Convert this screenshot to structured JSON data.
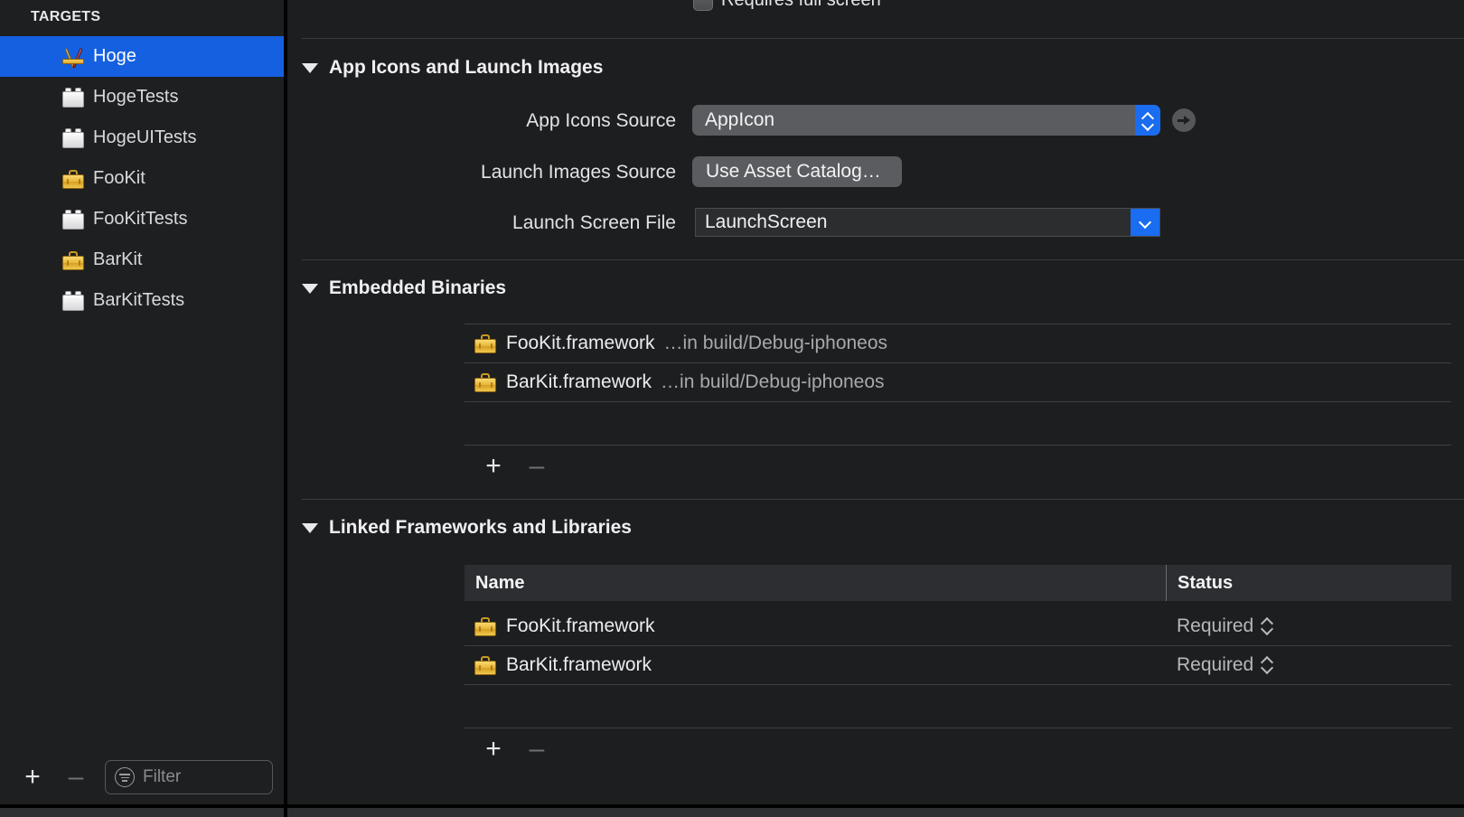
{
  "sidebar": {
    "header": "TARGETS",
    "targets": [
      {
        "label": "Hoge",
        "icon": "app-target-icon",
        "selected": true
      },
      {
        "label": "HogeTests",
        "icon": "test-bundle-icon",
        "selected": false
      },
      {
        "label": "HogeUITests",
        "icon": "test-bundle-icon",
        "selected": false
      },
      {
        "label": "FooKit",
        "icon": "framework-icon",
        "selected": false
      },
      {
        "label": "FooKitTests",
        "icon": "test-bundle-icon",
        "selected": false
      },
      {
        "label": "BarKit",
        "icon": "framework-icon",
        "selected": false
      },
      {
        "label": "BarKitTests",
        "icon": "test-bundle-icon",
        "selected": false
      }
    ],
    "footer": {
      "add_label": "+",
      "remove_label": "–",
      "filter_placeholder": "Filter",
      "filter_icon": "filter-icon"
    }
  },
  "main": {
    "clipped_checkbox": {
      "label": "Requires full screen",
      "checked": false
    },
    "app_icons_section": {
      "title": "App Icons and Launch Images",
      "disclosure_icon": "triangle-down-icon",
      "rows": [
        {
          "label": "App Icons Source",
          "value": "AppIcon",
          "control": "popup-button"
        },
        {
          "label": "Launch Images Source",
          "value": "Use Asset Catalog…",
          "control": "push-button"
        },
        {
          "label": "Launch Screen File",
          "value": "LaunchScreen",
          "control": "combo-box"
        }
      ],
      "goto_button_icon": "arrow-right-circle-icon"
    },
    "embedded_binaries": {
      "title": "Embedded Binaries",
      "disclosure_icon": "triangle-down-icon",
      "items": [
        {
          "name": "FooKit.framework",
          "path": "…in build/Debug-iphoneos",
          "icon": "framework-icon"
        },
        {
          "name": "BarKit.framework",
          "path": "…in build/Debug-iphoneos",
          "icon": "framework-icon"
        }
      ],
      "add_label": "+",
      "remove_label": "–"
    },
    "linked_frameworks": {
      "title": "Linked Frameworks and Libraries",
      "disclosure_icon": "triangle-down-icon",
      "columns": [
        "Name",
        "Status"
      ],
      "rows": [
        {
          "name": "FooKit.framework",
          "status": "Required",
          "icon": "framework-icon"
        },
        {
          "name": "BarKit.framework",
          "status": "Required",
          "icon": "framework-icon"
        }
      ],
      "add_label": "+",
      "remove_label": "–"
    }
  },
  "colors": {
    "selection_blue": "#1560e0",
    "control_blue": "#1a6cf0",
    "sidebar_bg": "#1e1f21",
    "main_bg": "#1d1e20",
    "framework_yellow": "#e8b63a"
  }
}
